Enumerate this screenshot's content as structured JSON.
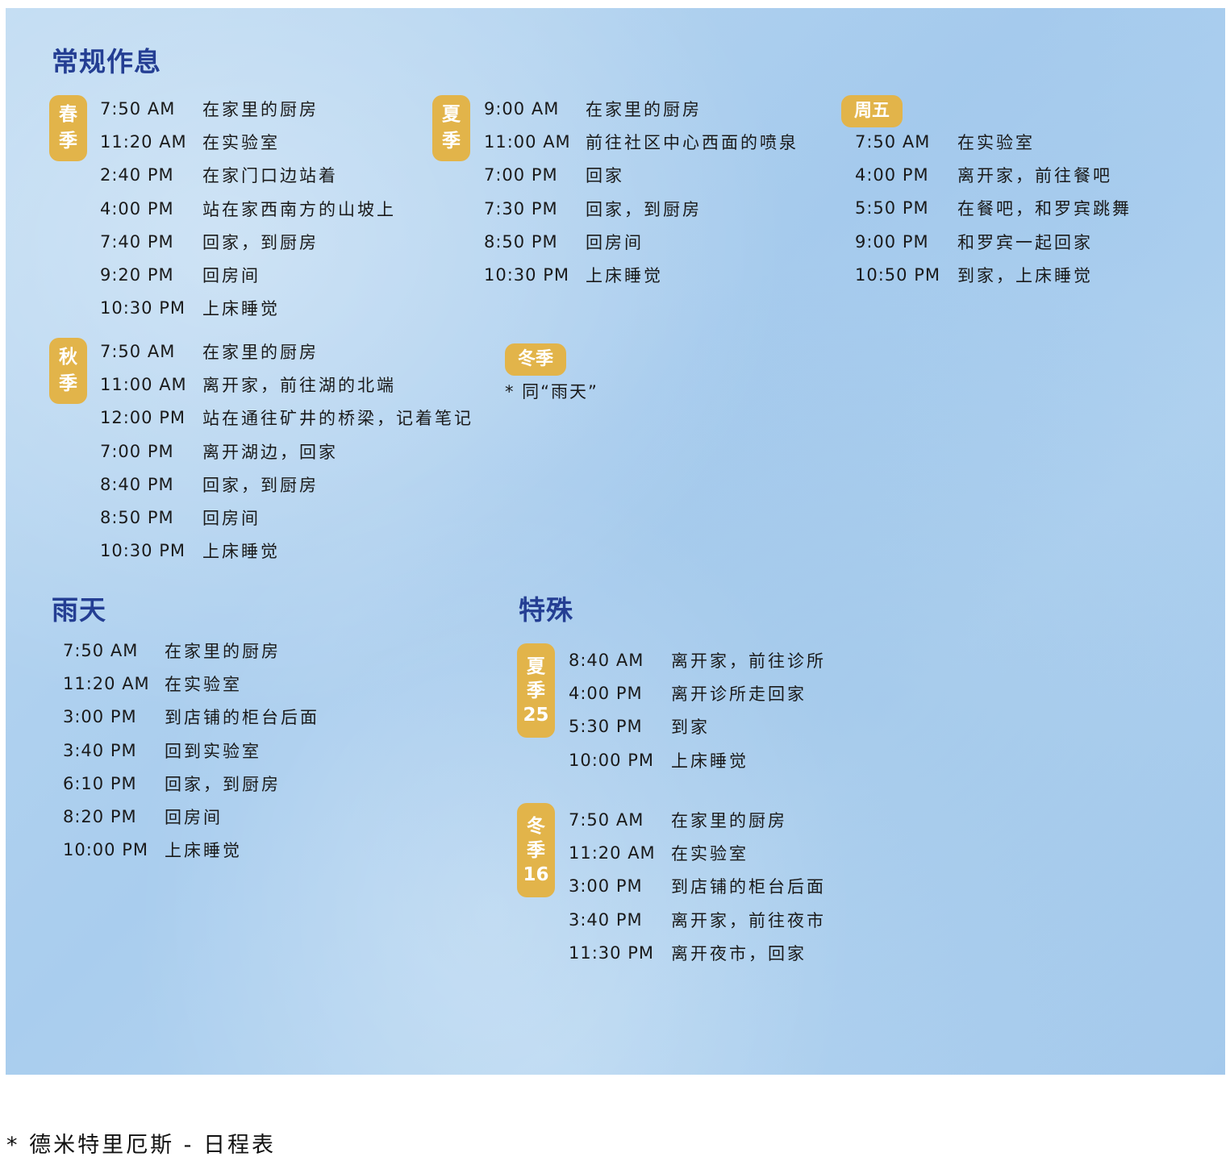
{
  "regular": {
    "title": "常规作息",
    "spring": {
      "badge": [
        "春",
        "季"
      ],
      "rows": [
        {
          "time": "7:50 AM",
          "activity": "在家里的厨房"
        },
        {
          "time": "11:20 AM",
          "activity": "在实验室"
        },
        {
          "time": "2:40 PM",
          "activity": "在家门口边站着"
        },
        {
          "time": "4:00 PM",
          "activity": "站在家西南方的山坡上"
        },
        {
          "time": "7:40 PM",
          "activity": "回家，到厨房"
        },
        {
          "time": "9:20 PM",
          "activity": "回房间"
        },
        {
          "time": "10:30 PM",
          "activity": "上床睡觉"
        }
      ]
    },
    "summer": {
      "badge": [
        "夏",
        "季"
      ],
      "rows": [
        {
          "time": "9:00 AM",
          "activity": "在家里的厨房"
        },
        {
          "time": "11:00 AM",
          "activity": "前往社区中心西面的喷泉"
        },
        {
          "time": "7:00 PM",
          "activity": "回家"
        },
        {
          "time": "7:30 PM",
          "activity": "回家，到厨房"
        },
        {
          "time": "8:50 PM",
          "activity": "回房间"
        },
        {
          "time": "10:30 PM",
          "activity": "上床睡觉"
        }
      ]
    },
    "friday": {
      "badge": "周五",
      "rows": [
        {
          "time": "7:50 AM",
          "activity": "在实验室"
        },
        {
          "time": "4:00 PM",
          "activity": "离开家，前往餐吧"
        },
        {
          "time": "5:50 PM",
          "activity": "在餐吧，和罗宾跳舞"
        },
        {
          "time": "9:00 PM",
          "activity": "和罗宾一起回家"
        },
        {
          "time": "10:50 PM",
          "activity": "到家，上床睡觉"
        }
      ]
    },
    "autumn": {
      "badge": [
        "秋",
        "季"
      ],
      "rows": [
        {
          "time": "7:50 AM",
          "activity": "在家里的厨房"
        },
        {
          "time": "11:00 AM",
          "activity": "离开家，前往湖的北端"
        },
        {
          "time": "12:00 PM",
          "activity": "站在通往矿井的桥梁，记着笔记"
        },
        {
          "time": "7:00 PM",
          "activity": "离开湖边，回家"
        },
        {
          "time": "8:40 PM",
          "activity": "回家，到厨房"
        },
        {
          "time": "8:50 PM",
          "activity": "回房间"
        },
        {
          "time": "10:30 PM",
          "activity": "上床睡觉"
        }
      ]
    },
    "winter": {
      "badge": "冬季",
      "note": "* 同“雨天”"
    }
  },
  "rainy": {
    "title": "雨天",
    "rows": [
      {
        "time": "7:50 AM",
        "activity": "在家里的厨房"
      },
      {
        "time": "11:20 AM",
        "activity": "在实验室"
      },
      {
        "time": "3:00 PM",
        "activity": "到店铺的柜台后面"
      },
      {
        "time": "3:40 PM",
        "activity": "回到实验室"
      },
      {
        "time": "6:10 PM",
        "activity": "回家，到厨房"
      },
      {
        "time": "8:20 PM",
        "activity": "回房间"
      },
      {
        "time": "10:00 PM",
        "activity": "上床睡觉"
      }
    ]
  },
  "special": {
    "title": "特殊",
    "summer25": {
      "badge": [
        "夏",
        "季",
        "25"
      ],
      "rows": [
        {
          "time": "8:40 AM",
          "activity": "离开家，前往诊所"
        },
        {
          "time": "4:00 PM",
          "activity": "离开诊所走回家"
        },
        {
          "time": "5:30 PM",
          "activity": "到家"
        },
        {
          "time": "10:00 PM",
          "activity": "上床睡觉"
        }
      ]
    },
    "winter16": {
      "badge": [
        "冬",
        "季",
        "16"
      ],
      "rows": [
        {
          "time": "7:50 AM",
          "activity": "在家里的厨房"
        },
        {
          "time": "11:20 AM",
          "activity": "在实验室"
        },
        {
          "time": "3:00 PM",
          "activity": "到店铺的柜台后面"
        },
        {
          "time": "3:40 PM",
          "activity": "离开家，前往夜市"
        },
        {
          "time": "11:30 PM",
          "activity": "离开夜市，回家"
        }
      ]
    }
  },
  "footer": "* 德米特里厄斯 - 日程表",
  "colors": {
    "title": "#243e93",
    "badge": "#e2b44a",
    "background": "#b2d3f0"
  }
}
